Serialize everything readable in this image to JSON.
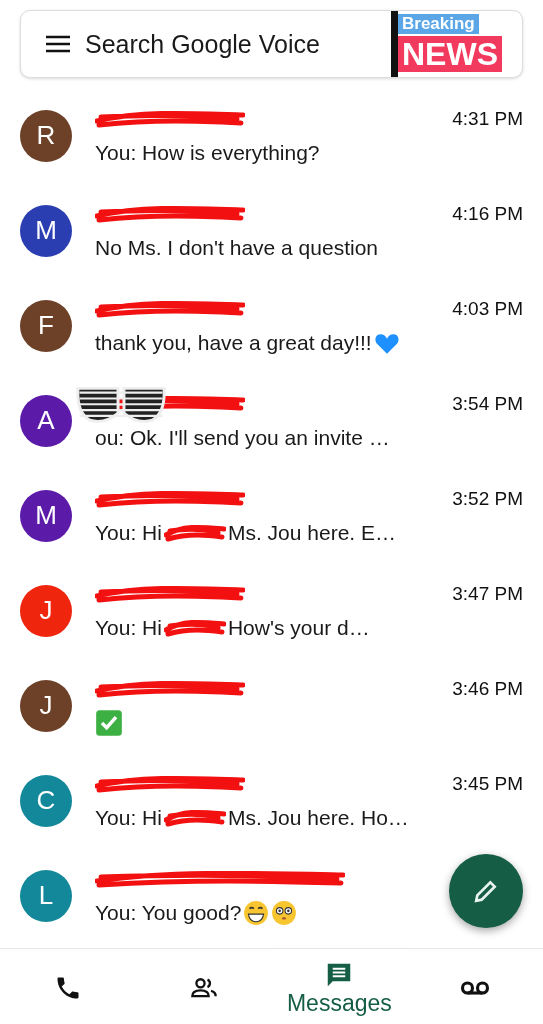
{
  "search": {
    "placeholder": "Search Google Voice"
  },
  "sticker": {
    "top": "Breaking",
    "bottom": "NEWS"
  },
  "conversations": [
    {
      "letter": "R",
      "color": "#6d4127",
      "time": "4:31 PM",
      "message": [
        {
          "kind": "text",
          "text": "You: How is everything?"
        }
      ]
    },
    {
      "letter": "M",
      "color": "#2a3eb1",
      "time": "4:16 PM",
      "message": [
        {
          "kind": "text",
          "text": "No Ms. I don't have a question"
        }
      ]
    },
    {
      "letter": "F",
      "color": "#6d4127",
      "time": "4:03 PM",
      "message": [
        {
          "kind": "text",
          "text": "thank you, have a great day!!!"
        },
        {
          "kind": "heart"
        }
      ]
    },
    {
      "letter": "A",
      "color": "#5b1aa8",
      "time": "3:54 PM",
      "sticker": {
        "kind": "sunglasses"
      },
      "message": [
        {
          "kind": "text",
          "text": "ou: Ok. I'll send you an invite …"
        }
      ]
    },
    {
      "letter": "M",
      "color": "#5b1aa8",
      "time": "3:52 PM",
      "message": [
        {
          "kind": "text",
          "text": "You: Hi"
        },
        {
          "kind": "redaction"
        },
        {
          "kind": "text",
          "text": "Ms. Jou here. E…"
        }
      ]
    },
    {
      "letter": "J",
      "color": "#f0250d",
      "time": "3:47 PM",
      "message": [
        {
          "kind": "text",
          "text": "You: Hi"
        },
        {
          "kind": "redaction"
        },
        {
          "kind": "text",
          "text": "How's your d…"
        }
      ]
    },
    {
      "letter": "J",
      "color": "#6d4127",
      "time": "3:46 PM",
      "message": [
        {
          "kind": "check"
        }
      ]
    },
    {
      "letter": "C",
      "color": "#12889a",
      "time": "3:45 PM",
      "message": [
        {
          "kind": "text",
          "text": "You: Hi"
        },
        {
          "kind": "redaction"
        },
        {
          "kind": "text",
          "text": "Ms. Jou here. Ho…"
        }
      ]
    },
    {
      "letter": "L",
      "color": "#12889a",
      "message": [
        {
          "kind": "text",
          "text": "You: You good?"
        },
        {
          "kind": "grin"
        },
        {
          "kind": "flushed"
        }
      ]
    }
  ],
  "nav": [
    {
      "kind": "calls",
      "selected": false
    },
    {
      "kind": "contacts",
      "selected": false
    },
    {
      "kind": "messages",
      "label": "Messages",
      "selected": true
    },
    {
      "kind": "voicemail",
      "selected": false
    }
  ]
}
